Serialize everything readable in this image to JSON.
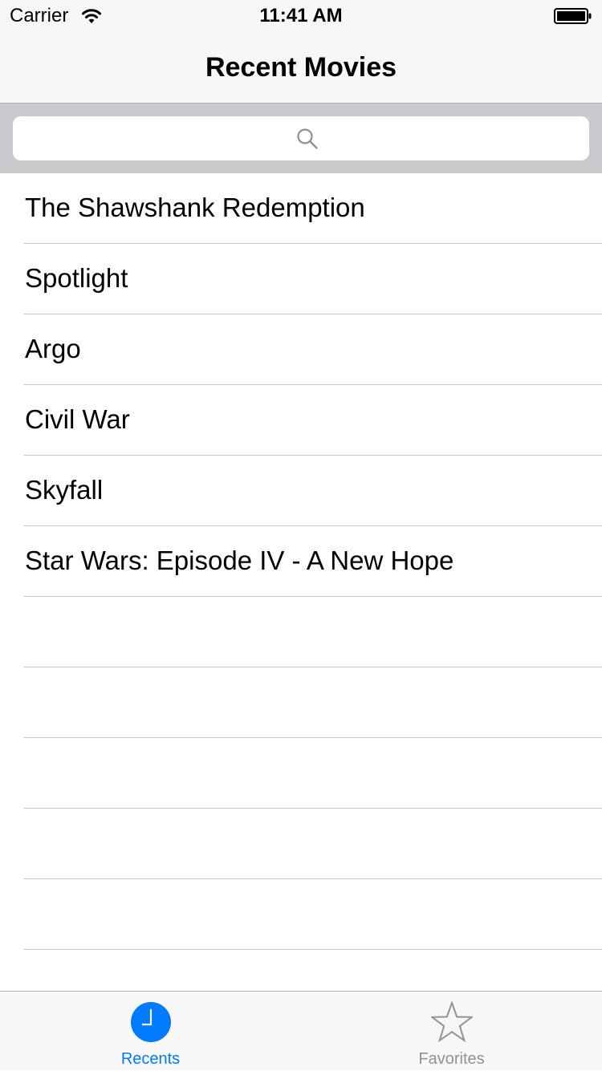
{
  "status_bar": {
    "carrier": "Carrier",
    "time": "11:41 AM"
  },
  "nav": {
    "title": "Recent Movies"
  },
  "search": {
    "placeholder": ""
  },
  "movies": [
    "The Shawshank Redemption",
    "Spotlight",
    "Argo",
    "Civil War",
    "Skyfall",
    "Star Wars: Episode IV - A New Hope"
  ],
  "tab_bar": {
    "tabs": [
      {
        "label": "Recents",
        "icon": "clock-icon",
        "selected": true
      },
      {
        "label": "Favorites",
        "icon": "star-icon",
        "selected": false
      }
    ]
  },
  "colors": {
    "accent": "#007aff",
    "inactive": "#929292"
  }
}
